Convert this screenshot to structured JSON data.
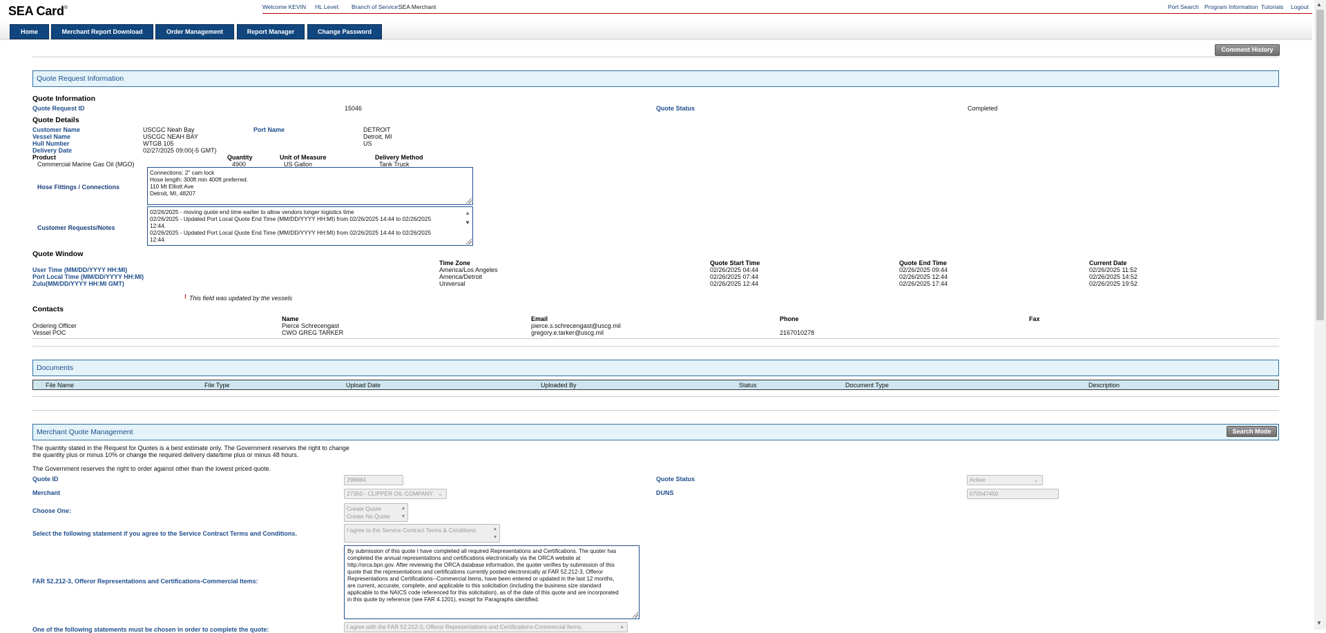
{
  "header": {
    "logo": "SEA Card",
    "logo_mark": "®",
    "welcome": "Welcome KEVIN",
    "hl_label": "HL Level:",
    "branch_label": "Branch of Service:",
    "branch_value": "SEA Merchant",
    "links": [
      "Port Search",
      "Program Information",
      "Tutorials",
      "Logout"
    ]
  },
  "nav": [
    "Home",
    "Merchant Report Download",
    "Order Management",
    "Report Manager",
    "Change Password"
  ],
  "comment_history_button": "Comment History",
  "quote_request": {
    "section_title": "Quote Request Information",
    "quote_info_heading": "Quote Information",
    "quote_request_id_label": "Quote Request ID",
    "quote_request_id": "15046",
    "quote_status_label": "Quote Status",
    "quote_status": "Completed",
    "details_heading": "Quote Details",
    "customer_name_label": "Customer Name",
    "customer_name": "USCGC Neah Bay",
    "port_name_label": "Port Name",
    "port_name": "DETROIT",
    "vessel_name_label": "Vessel Name",
    "vessel_name": "USCGC NEAH BAY",
    "port_location": "Detroit, MI",
    "hull_number_label": "Hull Number",
    "hull_number": "WTGB 105",
    "country": "US",
    "delivery_date_label": "Delivery Date",
    "delivery_date": "02/27/2025 09:00(-5 GMT)",
    "product_label": "Product",
    "quantity_label": "Quantity",
    "uom_label": "Unit of Measure",
    "delivery_method_label": "Delivery Method",
    "product": "Commercial Marine Gas Oil (MGO)",
    "quantity": "4900",
    "uom": "US Gallon",
    "delivery_method": "Tank Truck",
    "hose_label": "Hose Fittings / Connections",
    "hose_lines": [
      "Connections: 2\" cam lock",
      "Hose length: 300ft min 400ft preferred.",
      "110 Mt Elliott Ave",
      "Detroit, MI, 48207"
    ],
    "notes_label": "Customer Requests/Notes",
    "notes_lines": [
      "02/26/2025 - moving quote end time earlier to allow vendors longer logistics time",
      "02/26/2025 - Updated Port Local Quote End Time (MM/DD/YYYY HH:MI) from 02/26/2025 14:44 to 02/26/2025",
      "12:44.",
      "02/26/2025 - Updated Port Local Quote End Time (MM/DD/YYYY HH:MI) from 02/26/2025 14:44 to 02/26/2025",
      "12:44."
    ]
  },
  "quote_window": {
    "heading": "Quote Window",
    "headers": [
      "Time Zone",
      "Quote Start Time",
      "Quote End Time",
      "Current Date"
    ],
    "rows": [
      {
        "label": "User Time (MM/DD/YYYY HH:MI)",
        "tz": "America/Los Angeles",
        "start": "02/26/2025 04:44",
        "end": "02/26/2025 09:44",
        "current": "02/26/2025 11:52"
      },
      {
        "label": "Port Local Time (MM/DD/YYYY HH:MI)",
        "tz": "America/Detroit",
        "start": "02/26/2025 07:44",
        "end": "02/26/2025 12:44",
        "current": "02/26/2025 14:52"
      },
      {
        "label": "Zulu(MM/DD/YYYY HH:MI GMT)",
        "tz": "Universal",
        "start": "02/26/2025 12:44",
        "end": "02/26/2025 17:44",
        "current": "02/26/2025 19:52"
      }
    ],
    "note_marker": "!",
    "note": "This field was updated by the vessels"
  },
  "contacts": {
    "heading": "Contacts",
    "headers": [
      "Name",
      "Email",
      "Phone",
      "Fax"
    ],
    "rows": [
      {
        "role": "Ordering Officer",
        "name": "Pierce Schrecengast",
        "email": "pierce.s.schrecengast@uscg.mil",
        "phone": "",
        "fax": ""
      },
      {
        "role": "Vessel POC",
        "name": "CWO GREG TARKER",
        "email": "gregory.e.tarker@uscg.mil",
        "phone": "2167010278",
        "fax": ""
      }
    ]
  },
  "documents": {
    "section_title": "Documents",
    "columns": [
      "File Name",
      "File Type",
      "Upload Date",
      "Uploaded By",
      "Status",
      "Document Type",
      "Description"
    ]
  },
  "merchant": {
    "section_title": "Merchant Quote Management",
    "search_mode_button": "Search Mode",
    "disclaimer1": "The quantity stated in the Request for Quotes is a best estimate only. The Government reserves the right to change",
    "disclaimer1b": "the quantity plus or minus 10% or change the required delivery date/time plus or minus 48 hours.",
    "disclaimer2": "The Government reserves the right to order against other than the lowest priced quote.",
    "quote_id_label": "Quote ID",
    "quote_id": "298884",
    "quote_status_label": "Quote Status",
    "quote_status": "Active",
    "merchant_label": "Merchant",
    "merchant": "27350 - CLIPPER OIL COMPANY",
    "duns_label": "DUNS",
    "duns": "070547450",
    "choose_label": "Choose One:",
    "choose_options": [
      "Create Quote",
      "Create No Quote"
    ],
    "terms_label": "Select the following statement if you agree to the Service Contract Terms and Conditions.",
    "terms_option": "I agree to the Service Contract Terms & Conditions.",
    "far_label": "FAR 52.212-3, Offeror Representations and Certifications-Commercial Items:",
    "far_lines": [
      "By submission of this quote I have completed all required Representations and Certifications.  The quoter has",
      "completed the annual representations and certifications electronically via the ORCA website at",
      "http://orca.bpn.gov. After reviewing the ORCA database information, the quoter verifies by submission of this",
      "quote that the representations and certifications currently posted electronically at FAR 52.212-3, Offeror",
      "Representations and Certifications--Commercial Items, have been entered or updated in the last 12 months,",
      "are current, accurate, complete, and applicable to this solicitation (including the business size standard",
      "applicable to the NAICS code referenced for this solicitation), as of the date of this quote and are incorporated",
      "in this quote by reference (see FAR 4.1201), except for Paragraphs identified."
    ],
    "bottom_label": "One of the following statements must be chosen in order to complete the quote:",
    "bottom_option": "I agree with the FAR 52.212-3, Offeror Representations and Certifications-Commercial Items."
  },
  "colors": {
    "accent": "#11467e",
    "label": "#1f4e8c",
    "section_bg": "#e3f3f9",
    "top_rule": "#bb0000"
  }
}
